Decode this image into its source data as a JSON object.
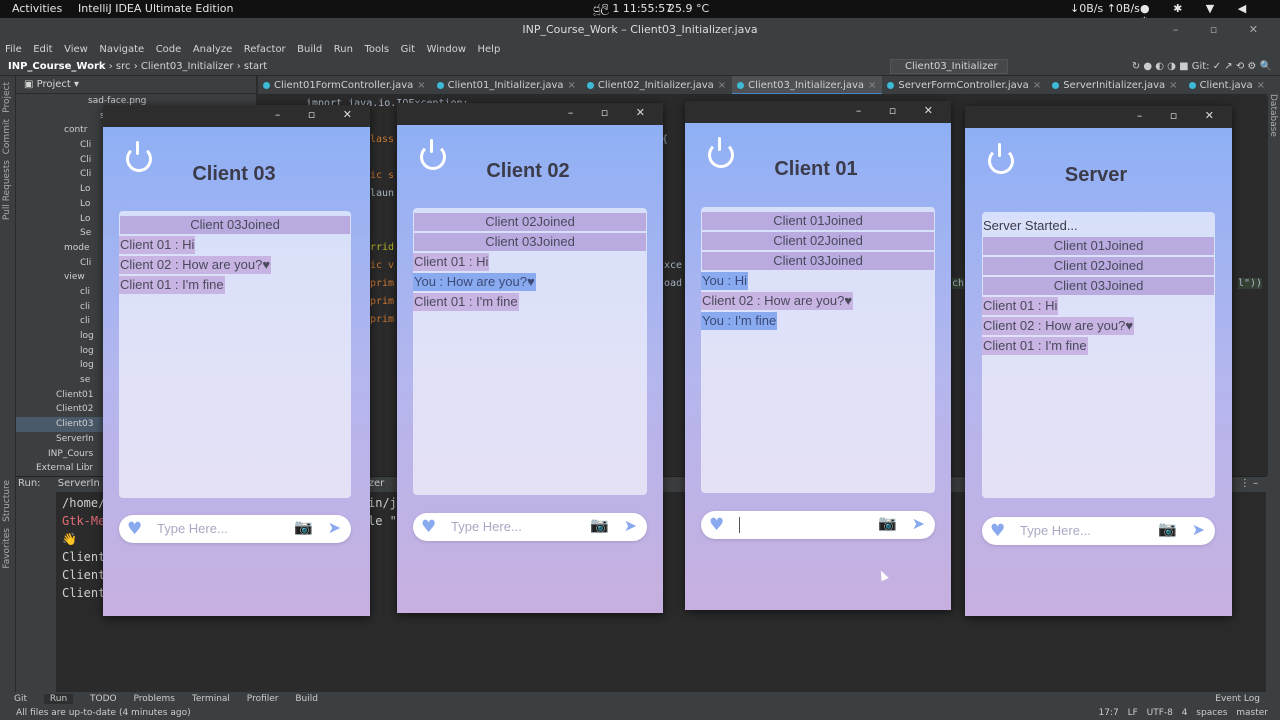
{
  "topbar": {
    "activities": "Activities",
    "app": "IntelliJ IDEA Ultimate Edition",
    "clock": "ජූලි 1  11:55:57",
    "temperature": "25.9 °C",
    "network": "↓0B/s ↑0B/s"
  },
  "ide": {
    "title": "INP_Course_Work – Client03_Initializer.java",
    "menu": [
      "File",
      "Edit",
      "View",
      "Navigate",
      "Code",
      "Analyze",
      "Refactor",
      "Build",
      "Run",
      "Tools",
      "Git",
      "Window",
      "Help"
    ],
    "breadcrumb": {
      "project": "INP_Course_Work",
      "src": "src",
      "file": "Client03_Initializer",
      "method": "start"
    },
    "run_config": "Client03_Initializer",
    "git_label": "Git:",
    "tabs": [
      "Client01FormController.java",
      "Client01_Initializer.java",
      "Client02_Initializer.java",
      "Client03_Initializer.java",
      "ServerFormController.java",
      "ServerInitializer.java",
      "Client.java",
      "Client"
    ],
    "project_header": "Project",
    "tree": [
      "sad-face.png",
      "sm",
      "contr",
      "Cli",
      "Cli",
      "Cli",
      "Lo",
      "Lo",
      "Lo",
      "Se",
      "mode",
      "Cli",
      "view",
      "cli",
      "cli",
      "cli",
      "log",
      "log",
      "log",
      "se",
      "Client01",
      "Client02",
      "Client03",
      "ServerIn",
      "INP_Cours",
      "External Libr"
    ],
    "stripe_left": [
      "Project",
      "Commit",
      "Pull Requests",
      "Structure",
      "Favorites"
    ],
    "stripe_right": "Database",
    "editor_snippets": [
      "import java.io.IOException;",
      "lass",
      "n {",
      "ic s",
      "laun",
      "rrid",
      "ic v",
      "xce",
      "prim",
      "oad",
      "prim",
      "prim",
      "ch",
      "l\"))"
    ],
    "run": {
      "label": "Run:",
      "config": "ServerIn",
      "config2": "izer"
    },
    "console": [
      "/home/",
      "Gtk-Me",
      "👋",
      "Client",
      "Client",
      "Client"
    ],
    "console_right": [
      "in/j",
      "le \""
    ],
    "bottom_tools": [
      "Git",
      "Run",
      "TODO",
      "Problems",
      "Terminal",
      "Profiler",
      "Build"
    ],
    "event_log": "Event Log",
    "status": "All files are up-to-date (4 minutes ago)",
    "status_right": "17:7  LF  UTF-8  4 spaces  master"
  },
  "windows": [
    {
      "title": "Client 03",
      "placeholder": "Type Here...",
      "lines": [
        {
          "type": "join",
          "text": "Client 03Joined"
        },
        {
          "type": "msg",
          "text": "Client 01 : Hi"
        },
        {
          "type": "msg",
          "text": "Client 02 : How are you?♥"
        },
        {
          "type": "msg",
          "text": "Client 01 : I'm fine"
        }
      ]
    },
    {
      "title": "Client 02",
      "placeholder": "Type Here...",
      "lines": [
        {
          "type": "join",
          "text": "Client 02Joined"
        },
        {
          "type": "join",
          "text": "Client 03Joined"
        },
        {
          "type": "msg",
          "text": "Client 01 : Hi"
        },
        {
          "type": "me",
          "text": "You : How are you?♥"
        },
        {
          "type": "msg",
          "text": "Client 01 : I'm fine"
        }
      ]
    },
    {
      "title": "Client 01",
      "placeholder": "",
      "lines": [
        {
          "type": "join",
          "text": "Client 01Joined"
        },
        {
          "type": "join",
          "text": "Client 02Joined"
        },
        {
          "type": "join",
          "text": "Client 03Joined"
        },
        {
          "type": "me",
          "text": "You : Hi"
        },
        {
          "type": "msg",
          "text": "Client 02 : How are you?♥"
        },
        {
          "type": "me",
          "text": "You : I'm fine"
        }
      ]
    },
    {
      "title": "Server",
      "placeholder": "Type Here...",
      "lines": [
        {
          "type": "plain",
          "text": "Server Started..."
        },
        {
          "type": "join",
          "text": "Client 01Joined"
        },
        {
          "type": "join",
          "text": "Client 02Joined"
        },
        {
          "type": "join",
          "text": "Client 03Joined"
        },
        {
          "type": "msg",
          "text": "Client 01 : Hi"
        },
        {
          "type": "msg",
          "text": "Client 02 : How are you?♥"
        },
        {
          "type": "msg",
          "text": "Client 01 : I'm fine"
        }
      ]
    }
  ],
  "colors": {
    "gradient_top": "#8fb0f5",
    "gradient_bottom": "#c7b0e0",
    "join_bg": "#b9abe0",
    "msg_bg": "#c7b4e3",
    "me_bg": "#8aaaf0",
    "icon": "#8aaaf0"
  },
  "icons": {
    "power": "power-icon",
    "heart": "heart-icon",
    "camera": "camera-icon",
    "send": "send-icon"
  }
}
